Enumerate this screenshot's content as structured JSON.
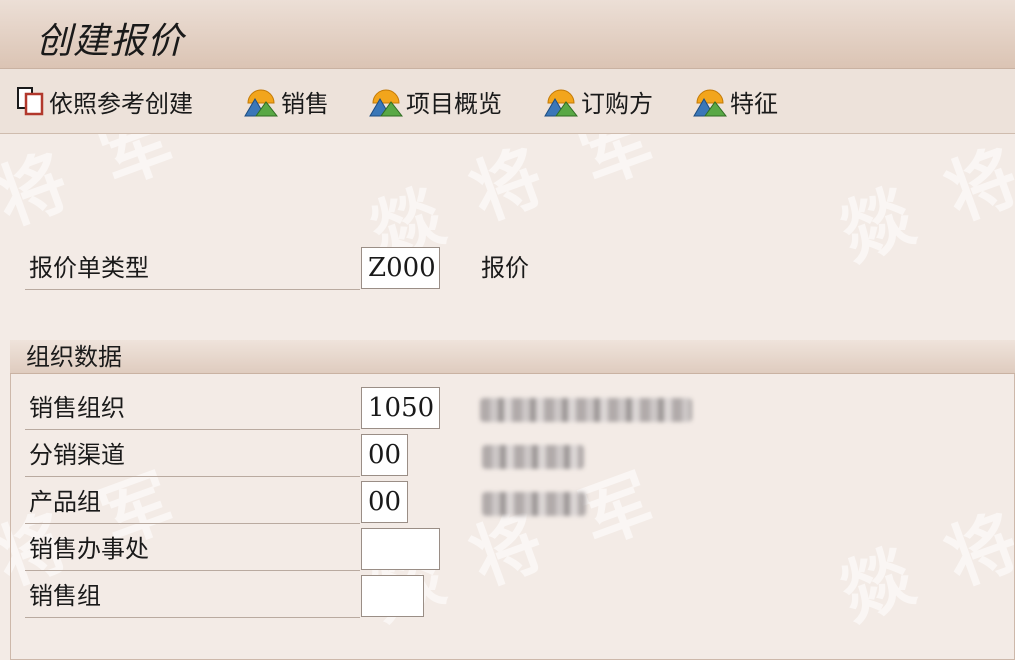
{
  "window": {
    "title": "创建报价"
  },
  "toolbar": {
    "items": [
      {
        "label": "依照参考创建",
        "icon": "create-with-reference-icon"
      },
      {
        "label": "销售",
        "icon": "mountain-sun-icon"
      },
      {
        "label": "项目概览",
        "icon": "mountain-sun-icon"
      },
      {
        "label": "订购方",
        "icon": "mountain-sun-icon"
      },
      {
        "label": "特征",
        "icon": "mountain-sun-icon"
      }
    ]
  },
  "quote_type": {
    "label": "报价单类型",
    "value": "Z000",
    "description": "报价"
  },
  "org_data": {
    "title": "组织数据",
    "sales_org": {
      "label": "销售组织",
      "value": "1050"
    },
    "dist_channel": {
      "label": "分销渠道",
      "value": "00"
    },
    "division": {
      "label": "产品组",
      "value": "00"
    },
    "sales_office": {
      "label": "销售办事处",
      "value": ""
    },
    "sales_group": {
      "label": "销售组",
      "value": ""
    }
  },
  "watermark": {
    "chars": [
      "将",
      "军",
      "燚"
    ]
  },
  "colors": {
    "background": "#f3ebe6",
    "titlebar": "#dbc4b4",
    "accent_orange": "#f2a51c"
  }
}
